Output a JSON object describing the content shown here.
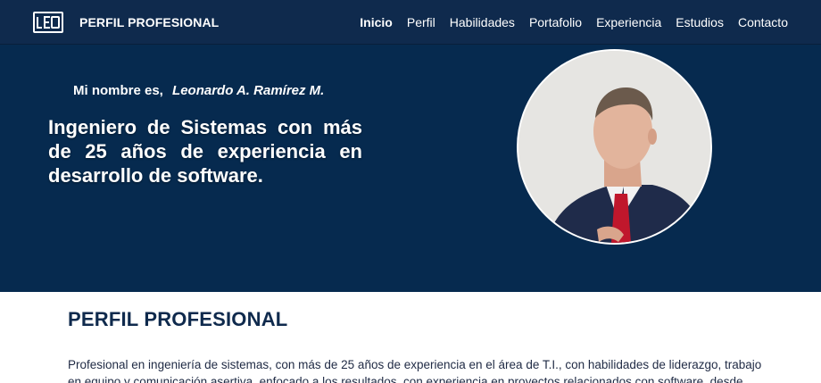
{
  "header": {
    "logo_text": "LEO",
    "brand_title": "PERFIL PROFESIONAL",
    "nav": [
      {
        "label": "Inicio",
        "active": true
      },
      {
        "label": "Perfil"
      },
      {
        "label": "Habilidades"
      },
      {
        "label": "Portafolio"
      },
      {
        "label": "Experiencia"
      },
      {
        "label": "Estudios"
      },
      {
        "label": "Contacto"
      }
    ]
  },
  "hero": {
    "intro_prefix": "Mi nombre es,",
    "name": "Leonardo A. Ramírez M.",
    "headline": "Ingeniero de Sistemas con más de 25 años de experiencia en desarrollo de software.",
    "photo_icon": "profile-photo"
  },
  "profile": {
    "title": "PERFIL PROFESIONAL",
    "text": "Profesional en ingeniería de sistemas, con más de 25 años de experiencia en el área de T.I., con habilidades de liderazgo, trabajo en equipo y comunicación asertiva, enfocado a los resultados, con experiencia en proyectos relacionados con software, desde"
  },
  "colors": {
    "navbar": "#0f2a4d",
    "hero_bg": "#062a4f",
    "text_dark": "#0f2a4d"
  }
}
